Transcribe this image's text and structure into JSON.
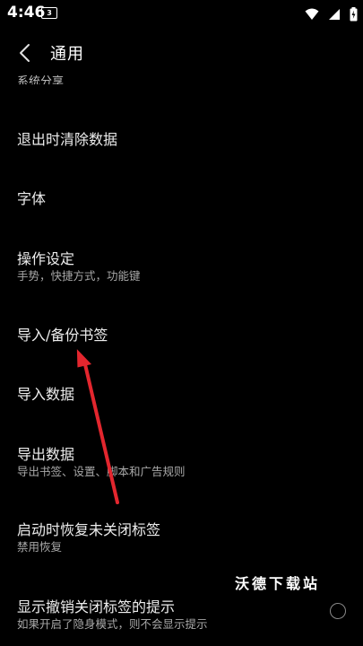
{
  "status_bar": {
    "time": "4:46",
    "sim_badge": "3",
    "icons": [
      "wifi-icon",
      "signal-icon",
      "battery-charging-icon"
    ]
  },
  "header": {
    "back_icon": "chevron-left-icon",
    "title": "通用"
  },
  "partial_item": {
    "label": "系统分享"
  },
  "items": [
    {
      "label": "退出时清除数据",
      "desc": ""
    },
    {
      "label": "字体",
      "desc": ""
    },
    {
      "label": "操作设定",
      "desc": "手势，快捷方式，功能键"
    },
    {
      "label": "导入/备份书签",
      "desc": ""
    },
    {
      "label": "导入数据",
      "desc": ""
    },
    {
      "label": "导出数据",
      "desc": "导出书签、设置、脚本和广告规则"
    },
    {
      "label": "启动时恢复未关闭标签",
      "desc": "禁用恢复"
    },
    {
      "label": "显示撤销关闭标签的提示",
      "desc": "如果开启了隐身模式，则不会显示提示"
    }
  ],
  "watermark": "沃德下载站",
  "colors": {
    "background": "#000000",
    "text_primary": "#ededed",
    "text_secondary": "#a8a8a8",
    "annotation_arrow": "#e3262e"
  }
}
